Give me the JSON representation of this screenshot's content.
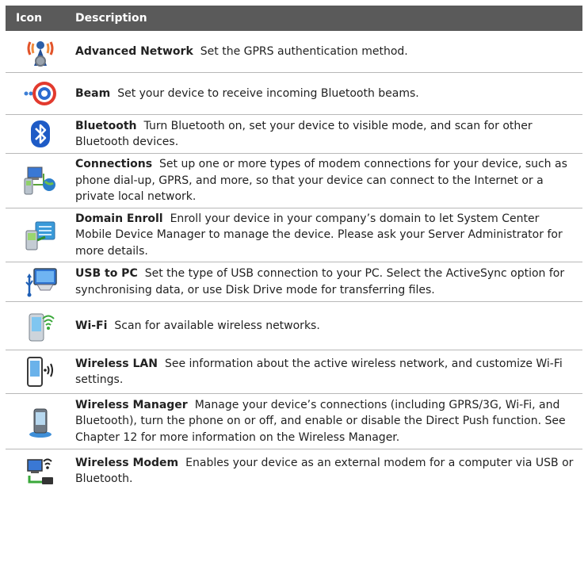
{
  "header": {
    "icon": "Icon",
    "description": "Description"
  },
  "rows": [
    {
      "name": "Advanced Network",
      "text": "Set the GPRS authentication method.",
      "icon": "advanced-network-icon"
    },
    {
      "name": "Beam",
      "text": "Set your device to receive incoming Bluetooth beams.",
      "icon": "beam-icon"
    },
    {
      "name": "Bluetooth",
      "text": "Turn Bluetooth on, set your device to visible mode, and scan for other Bluetooth devices.",
      "icon": "bluetooth-icon"
    },
    {
      "name": "Connections",
      "text": "Set up one or more types of modem connections for your device, such as phone dial-up, GPRS, and more, so that your device can connect to the Internet or a private local network.",
      "icon": "connections-icon"
    },
    {
      "name": "Domain Enroll",
      "text": "Enroll your device in your company’s domain to let System Center Mobile Device Manager to manage the device. Please ask your Server Administrator for more details.",
      "icon": "domain-enroll-icon"
    },
    {
      "name": "USB to PC",
      "text": "Set the type of USB connection to your PC. Select the ActiveSync option for synchronising data, or use Disk Drive mode for transferring files.",
      "icon": "usb-to-pc-icon"
    },
    {
      "name": "Wi-Fi",
      "text": "Scan for available wireless networks.",
      "icon": "wifi-icon"
    },
    {
      "name": "Wireless LAN",
      "text": "See information about the active wireless network, and customize Wi-Fi settings.",
      "icon": "wireless-lan-icon"
    },
    {
      "name": "Wireless Manager",
      "text": "Manage your device’s connections (including GPRS/3G, Wi-Fi, and Bluetooth), turn the phone on or off, and enable or disable the Direct Push function. See Chapter 12 for more information on the Wireless Manager.",
      "icon": "wireless-manager-icon"
    },
    {
      "name": "Wireless Modem",
      "text": "Enables your device as an external modem for a computer via USB or Bluetooth.",
      "icon": "wireless-modem-icon"
    }
  ]
}
